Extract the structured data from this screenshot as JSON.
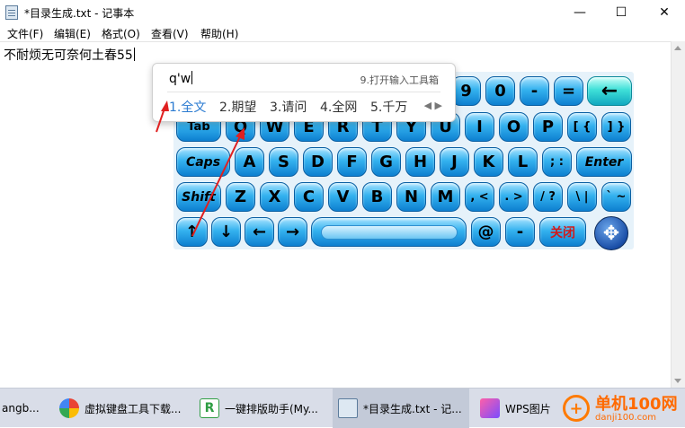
{
  "window": {
    "title": "*目录生成.txt - 记事本",
    "minimize_glyph": "—",
    "maximize_glyph": "☐",
    "close_glyph": "✕"
  },
  "menu": [
    "文件(F)",
    "编辑(E)",
    "格式(O)",
    "查看(V)",
    "帮助(H)"
  ],
  "editor": {
    "content": "不耐烦无可奈何土春55"
  },
  "ime": {
    "input": "q'w",
    "tools_label": "9.打开输入工具箱",
    "candidates": [
      "1.全文",
      "2.期望",
      "3.请问",
      "4.全网",
      "5.千万"
    ],
    "nav_glyph": "◀ ▶"
  },
  "keyboard": {
    "rows": [
      [
        "9",
        "0",
        "-",
        "=",
        "←"
      ],
      [
        "Tab",
        "Q",
        "W",
        "E",
        "R",
        "T",
        "Y",
        "U",
        "I",
        "O",
        "P",
        "[ {",
        "] }"
      ],
      [
        "Caps",
        "A",
        "S",
        "D",
        "F",
        "G",
        "H",
        "J",
        "K",
        "L",
        "; :",
        "Enter"
      ],
      [
        "Shift",
        "Z",
        "X",
        "C",
        "V",
        "B",
        "N",
        "M",
        ", <",
        ". >",
        "/ ?",
        "\\ |",
        "` ~"
      ],
      [
        "↑",
        "↓",
        "←",
        "→",
        "",
        "@",
        "-",
        "关闭"
      ]
    ],
    "move_glyph": "✥"
  },
  "taskbar": {
    "items": [
      "angb...",
      "虚拟键盘工具下载...",
      "一键排版助手(My...",
      "*目录生成.txt - 记...",
      "WPS图片"
    ]
  },
  "watermark": {
    "title": "单机100网",
    "url": "danji100.com",
    "badge": "+"
  },
  "colors": {
    "key_blue": "#1ea3ea",
    "key_cyan": "#3fe0d8",
    "annotation_red": "#e02020",
    "ime_selected": "#2b7bd1",
    "watermark_orange": "#ff6a00"
  }
}
